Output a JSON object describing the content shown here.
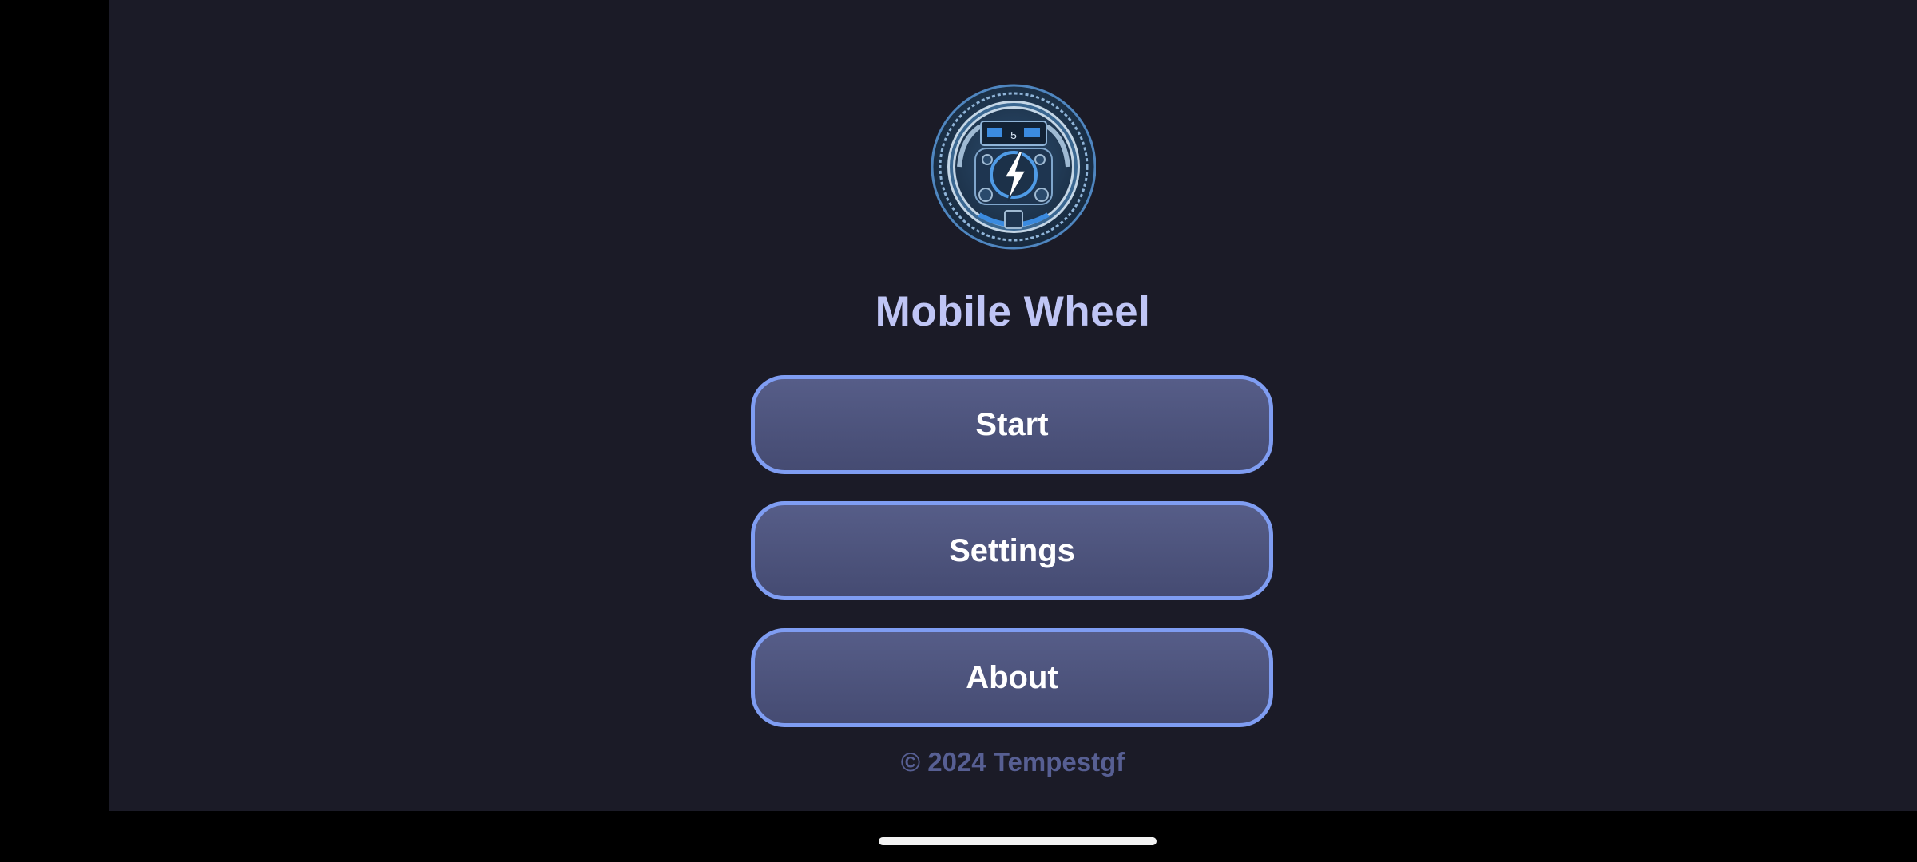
{
  "app": {
    "title": "Mobile Wheel",
    "logo_icon": "steering-wheel-lightning-icon",
    "logo_gauge_digit": "5",
    "background_color": "#1b1b27",
    "accent_color": "#7f9df2"
  },
  "menu": {
    "start_label": "Start",
    "settings_label": "Settings",
    "about_label": "About"
  },
  "footer": {
    "copyright": "© 2024 Tempestgf"
  }
}
